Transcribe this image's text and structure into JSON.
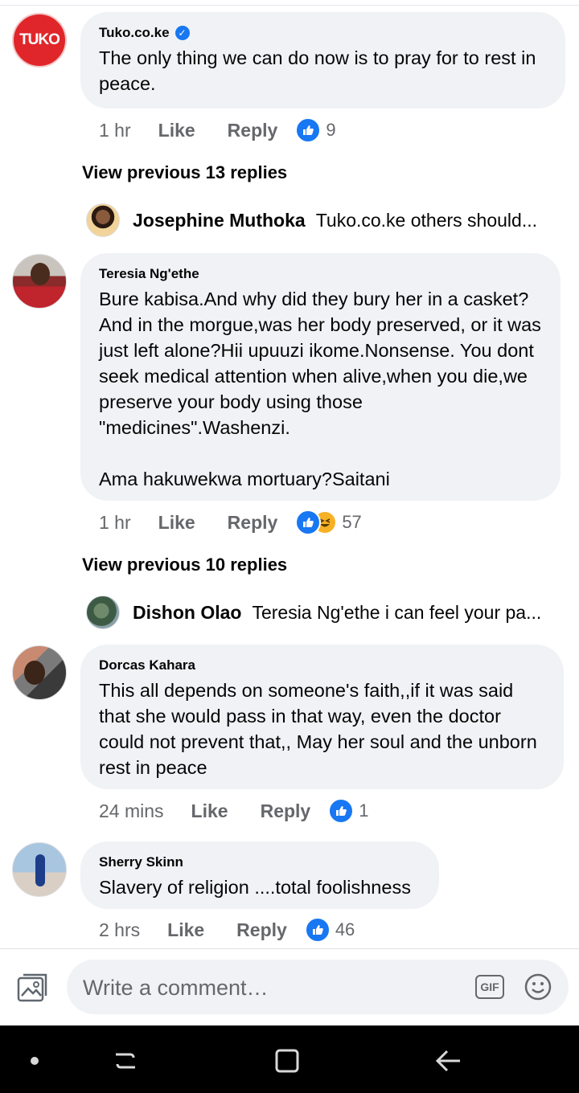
{
  "comments": [
    {
      "author": "Tuko.co.ke",
      "verified": true,
      "avatar_text": "TUKO",
      "text": "The only thing we can do now is to pray for to rest in peace.",
      "time": "1 hr",
      "like_label": "Like",
      "reply_label": "Reply",
      "reaction_count": "9",
      "view_previous": "View previous 13 replies",
      "latest_reply": {
        "author": "Josephine Muthoka",
        "text": "Tuko.co.ke others should..."
      }
    },
    {
      "author": "Teresia Ng'ethe",
      "text": "Bure kabisa.And why did they bury her in a casket?And in the morgue,was her body preserved, or it was just left alone?Hii upuuzi ikome.Nonsense. You dont seek medical attention when alive,when you die,we preserve your body using those \"medicines\".Washenzi.\n\nAma hakuwekwa mortuary?Saitani",
      "time": "1 hr",
      "like_label": "Like",
      "reply_label": "Reply",
      "reaction_count": "57",
      "view_previous": "View previous 10 replies",
      "latest_reply": {
        "author": "Dishon Olao",
        "text": "Teresia Ng'ethe i can feel your pa..."
      }
    },
    {
      "author": "Dorcas Kahara",
      "text": "This all depends on someone's faith,,if it was said that she would pass in that way, even the doctor could not prevent that,, May her soul and the unborn rest in peace",
      "time": "24 mins",
      "like_label": "Like",
      "reply_label": "Reply",
      "reaction_count": "1"
    },
    {
      "author": "Sherry Skinn",
      "text": "Slavery of religion ....total foolishness",
      "time": "2 hrs",
      "like_label": "Like",
      "reply_label": "Reply",
      "reaction_count": "46"
    }
  ],
  "composer": {
    "placeholder": "Write a comment…",
    "gif_label": "GIF"
  },
  "colors": {
    "accent": "#1877f2",
    "bubble": "#f0f2f5",
    "meta_text": "#65676b",
    "tuko_red": "#e0262a"
  },
  "icons": [
    "verified-badge-icon",
    "like-reaction-icon",
    "haha-reaction-icon",
    "photo-icon",
    "gif-icon",
    "emoji-icon",
    "nav-dot-icon",
    "recents-icon",
    "home-icon",
    "back-icon"
  ]
}
